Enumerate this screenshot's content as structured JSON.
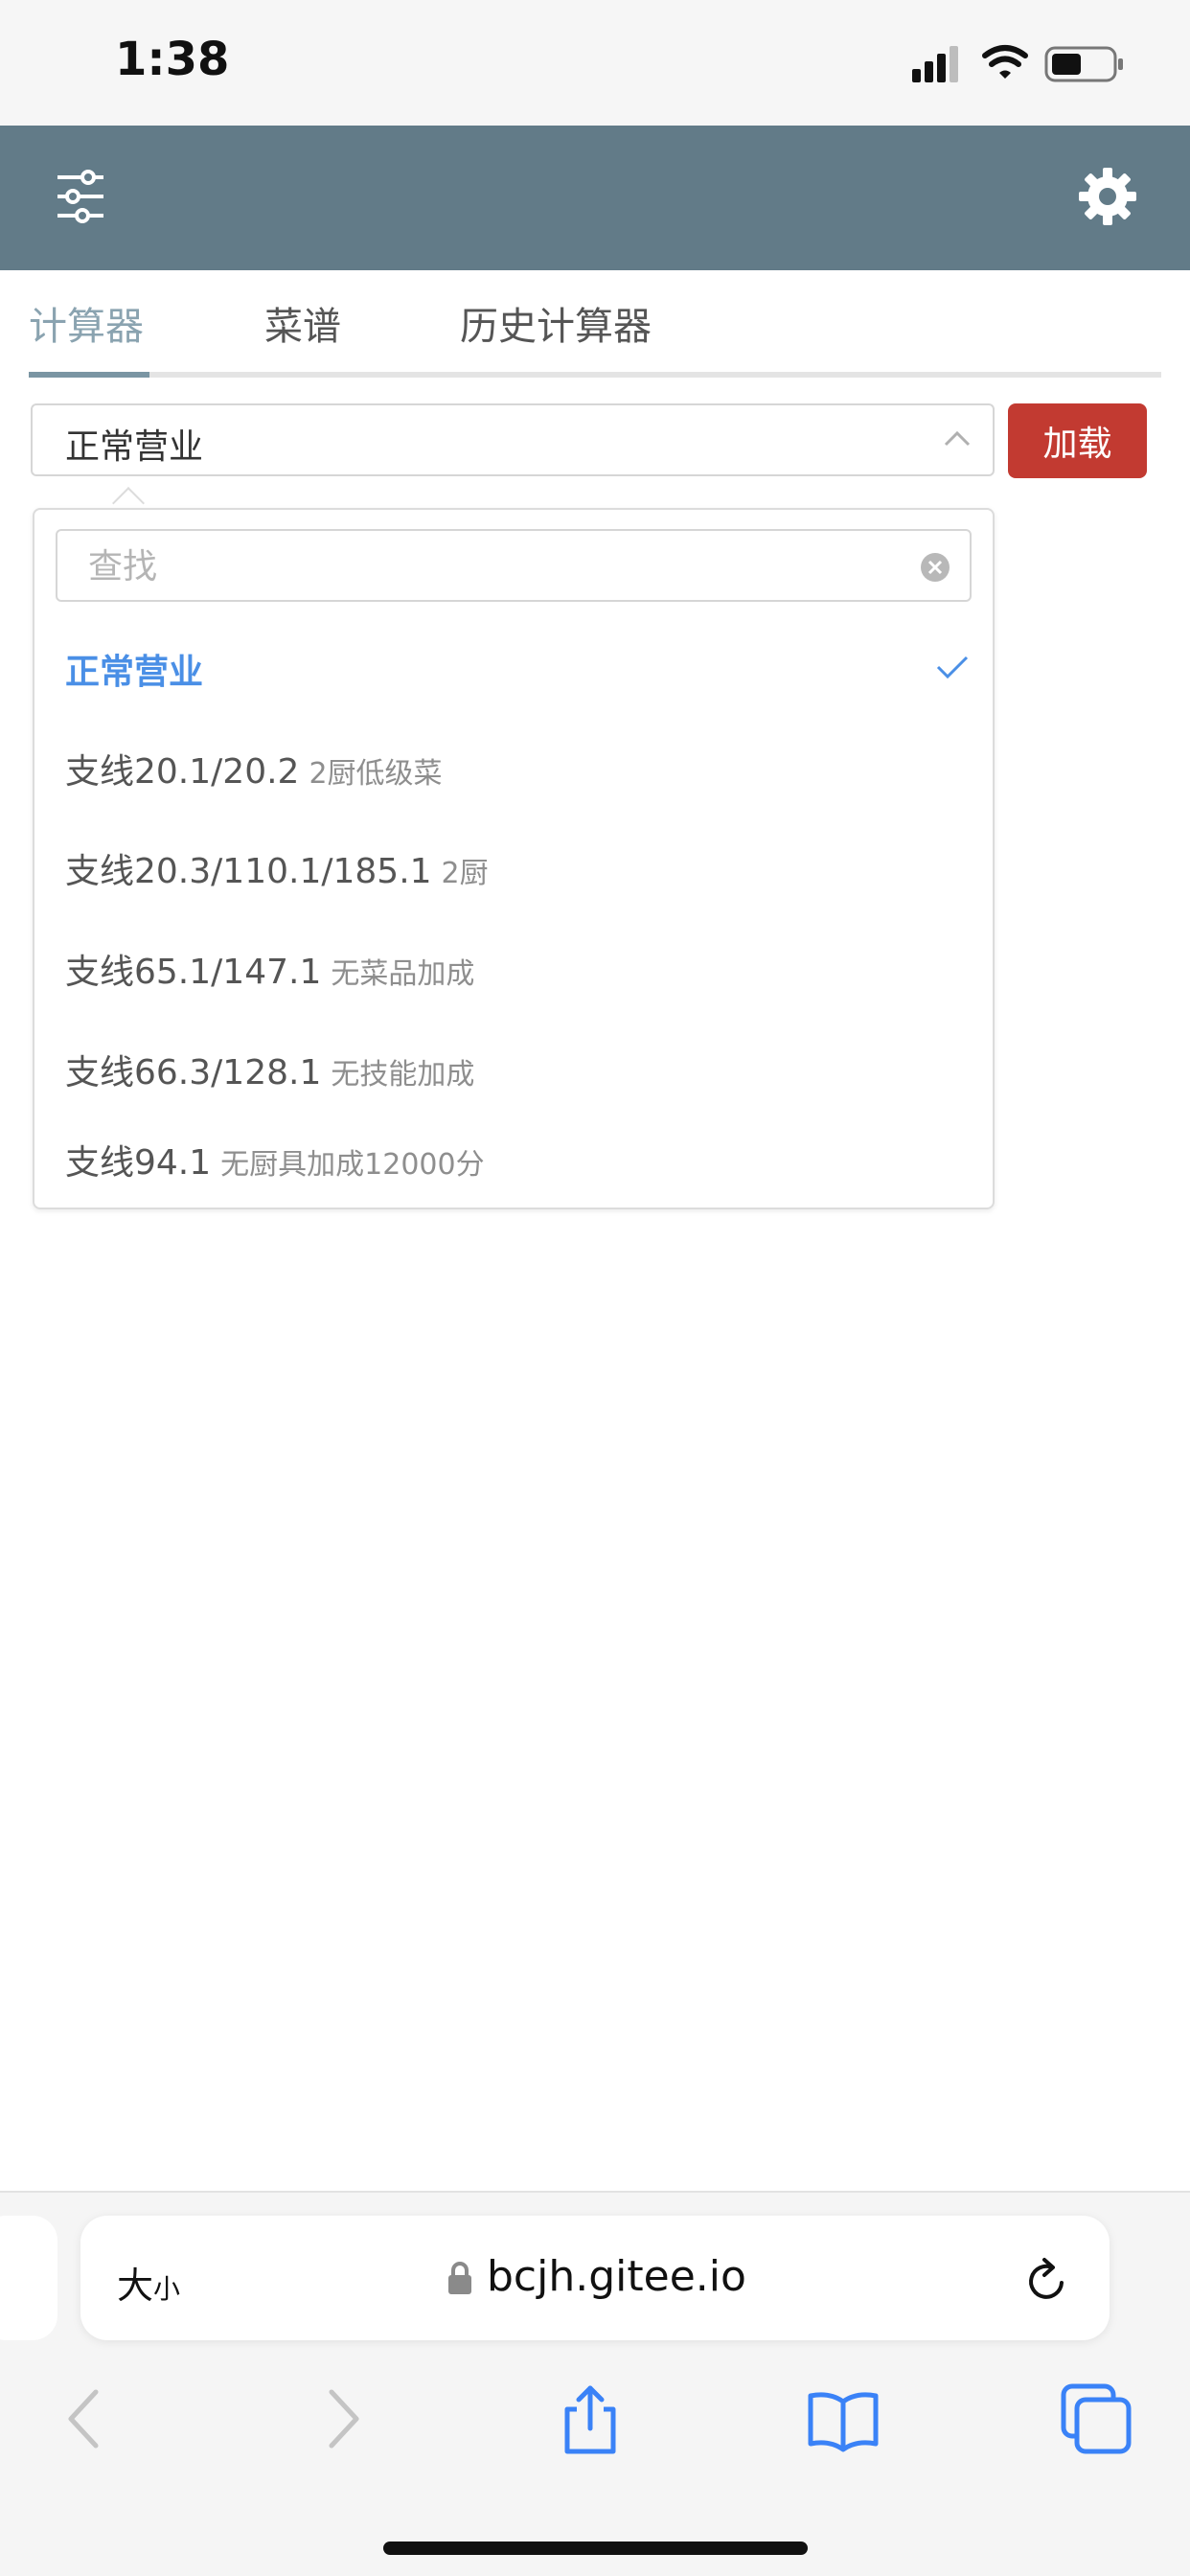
{
  "status_bar": {
    "time": "1:38",
    "icons": [
      "cellular-signal-icon",
      "wifi-icon",
      "battery-icon"
    ]
  },
  "header": {
    "left_icon": "filter-sliders-icon",
    "right_icon": "gear-icon",
    "background_color": "#627b88"
  },
  "tabs": [
    {
      "label": "计算器",
      "active": true
    },
    {
      "label": "菜谱",
      "active": false
    },
    {
      "label": "历史计算器",
      "active": false
    }
  ],
  "select": {
    "value": "正常营业",
    "load_label": "加载",
    "load_color": "#c23a31"
  },
  "dropdown": {
    "search_placeholder": "查找",
    "options": [
      {
        "label": "正常营业",
        "sub": "",
        "selected": true
      },
      {
        "label": "支线20.1/20.2",
        "sub": "2厨低级菜",
        "selected": false
      },
      {
        "label": "支线20.3/110.1/185.1",
        "sub": "2厨",
        "selected": false
      },
      {
        "label": "支线65.1/147.1",
        "sub": "无菜品加成",
        "selected": false
      },
      {
        "label": "支线66.3/128.1",
        "sub": "无技能加成",
        "selected": false
      },
      {
        "label": "支线94.1",
        "sub": "无厨具加成12000分",
        "selected": false
      }
    ],
    "selected_color": "#4a8fe6"
  },
  "browser": {
    "text_size_big": "大",
    "text_size_small": "小",
    "url": "bcjh.gitee.io",
    "toolbar_icons": [
      "back-icon",
      "forward-icon",
      "share-icon",
      "bookmarks-icon",
      "tabs-icon"
    ]
  }
}
